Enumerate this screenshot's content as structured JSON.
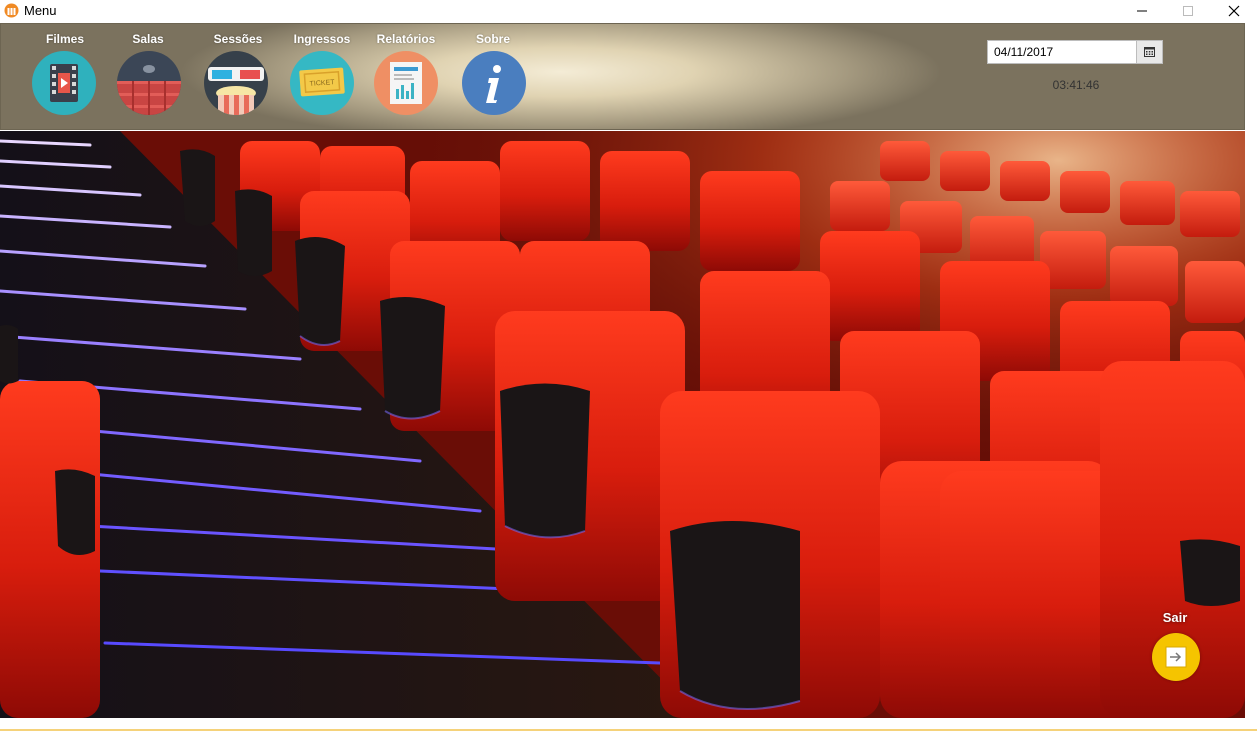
{
  "window": {
    "title": "Menu"
  },
  "menu": {
    "items": [
      {
        "label": "Filmes",
        "icon": "film-icon",
        "color": "#2fb1bd"
      },
      {
        "label": "Salas",
        "icon": "cinema-hall-icon",
        "color": "#3b4656"
      },
      {
        "label": "Sessões",
        "icon": "3d-glasses-popcorn-icon",
        "color": "#36404a"
      },
      {
        "label": "Ingressos",
        "icon": "ticket-icon",
        "color": "#35b8c4"
      },
      {
        "label": "Relatórios",
        "icon": "report-icon",
        "color": "#ef8f64"
      },
      {
        "label": "Sobre",
        "icon": "info-icon",
        "color": "#4a7ebf"
      }
    ]
  },
  "date": {
    "value": "04/11/2017"
  },
  "clock": {
    "time": "03:41:46"
  },
  "exit": {
    "label": "Sair",
    "color": "#f5c400"
  }
}
